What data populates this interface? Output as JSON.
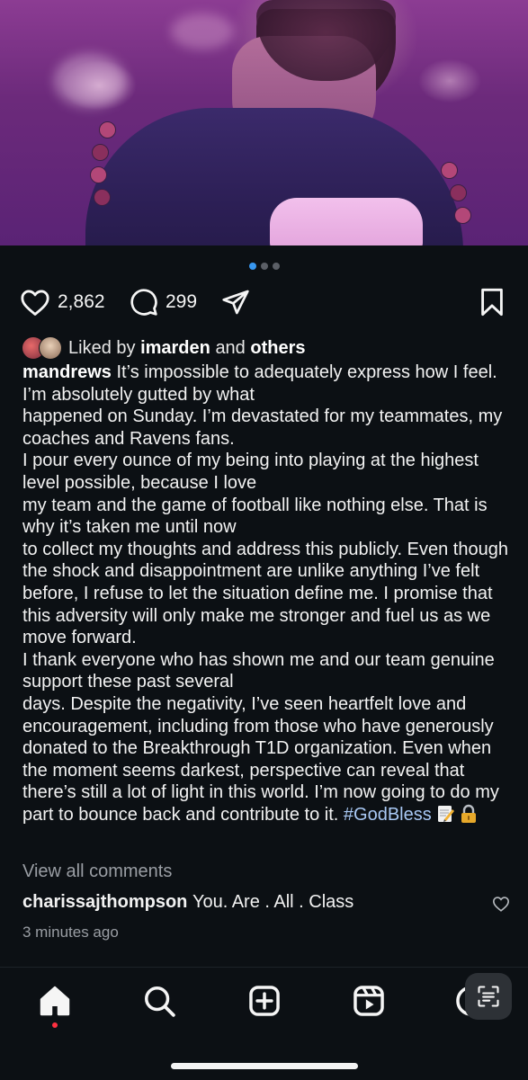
{
  "post": {
    "carousel": {
      "count": 3,
      "active": 1
    },
    "likes_count": "2,862",
    "comments_count": "299",
    "liked_by_prefix": "Liked by",
    "liked_by_user": "imarden",
    "liked_by_and": "and",
    "liked_by_others": "others",
    "author": "mandrews",
    "caption_lines": [
      " It’s impossible to adequately express how I feel. I’m absolutely gutted by what",
      "happened on Sunday. I’m devastated for my teammates, my coaches and Ravens fans.",
      "I pour every ounce of my being into playing at the highest level possible, because I love",
      "my team and the game of football like nothing else. That is why it’s taken me until now",
      "to collect my thoughts and address this publicly. Even though the shock and disappointment are unlike anything I’ve felt before, I refuse to let the situation define me. I promise that this adversity will only make me stronger and fuel us as we move forward.",
      "I thank everyone who has shown me and our team genuine support these past several",
      "days. Despite the negativity, I’ve seen heartfelt love and encouragement, including from those who have generously donated to the Breakthrough T1D organization. Even when the moment seems darkest, perspective can reveal that there’s still a lot of light in this world. I’m now going to do my part to bounce back and contribute to it. "
    ],
    "hashtag": "#GodBless",
    "emojis": [
      "memo-emoji",
      "lock-emoji"
    ],
    "view_all_comments": "View all comments",
    "top_comment": {
      "user": "charissajthompson",
      "text": "You. Are . All . Class"
    },
    "timestamp": "3 minutes ago"
  },
  "nav": {
    "items": [
      "home-icon",
      "search-icon",
      "create-icon",
      "reels-icon",
      "profile-icon"
    ],
    "active": "home"
  },
  "colors": {
    "background": "#0c1014",
    "accent": "#3897f0",
    "hashtag": "#a9c9f5",
    "notification": "#ff3040"
  }
}
